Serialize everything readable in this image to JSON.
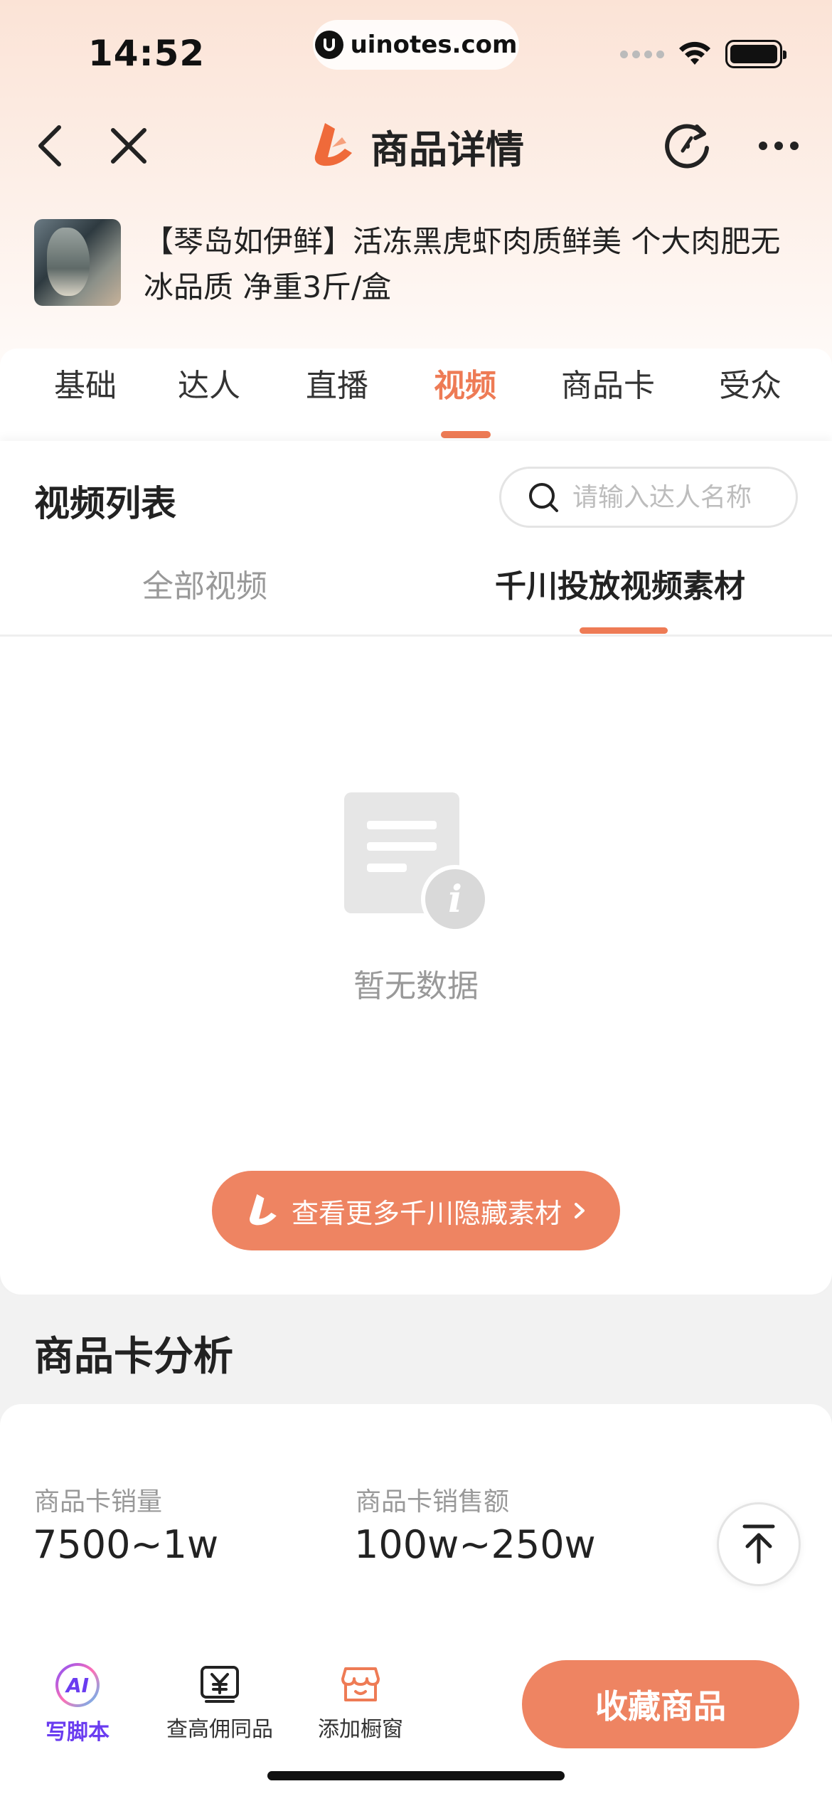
{
  "status_bar": {
    "time": "14:52",
    "url": "uinotes.com"
  },
  "nav": {
    "title": "商品详情",
    "icons": [
      "back-icon",
      "close-icon",
      "refresh-icon",
      "more-icon"
    ]
  },
  "product": {
    "title": "【琴岛如伊鲜】活冻黑虎虾肉质鲜美 个大肉肥无冰品质 净重3斤/盒"
  },
  "tabs": {
    "items": [
      {
        "label": "基础"
      },
      {
        "label": "达人"
      },
      {
        "label": "直播"
      },
      {
        "label": "视频"
      },
      {
        "label": "商品卡"
      },
      {
        "label": "受众"
      }
    ],
    "active": "视频"
  },
  "video_list": {
    "title": "视频列表",
    "search_placeholder": "请输入达人名称",
    "subtabs": [
      {
        "label": "全部视频"
      },
      {
        "label": "千川投放视频素材"
      }
    ],
    "active_subtab": "千川投放视频素材",
    "empty_text": "暂无数据",
    "cta_label": "查看更多千川隐藏素材"
  },
  "analysis": {
    "title": "商品卡分析",
    "stats": [
      {
        "label": "商品卡销量",
        "value": "7500~1w"
      },
      {
        "label": "商品卡销售额",
        "value": "100w~250w"
      }
    ]
  },
  "bottom_bar": {
    "ai_badge": "AI",
    "items": [
      {
        "label": "写脚本",
        "icon": "ai-icon"
      },
      {
        "label": "查高佣同品",
        "icon": "yen-icon"
      },
      {
        "label": "添加橱窗",
        "icon": "store-icon"
      }
    ],
    "primary_label": "收藏商品"
  },
  "colors": {
    "accent": "#ee7b55",
    "button": "#ee8462",
    "ai": "#6a3cf0"
  }
}
